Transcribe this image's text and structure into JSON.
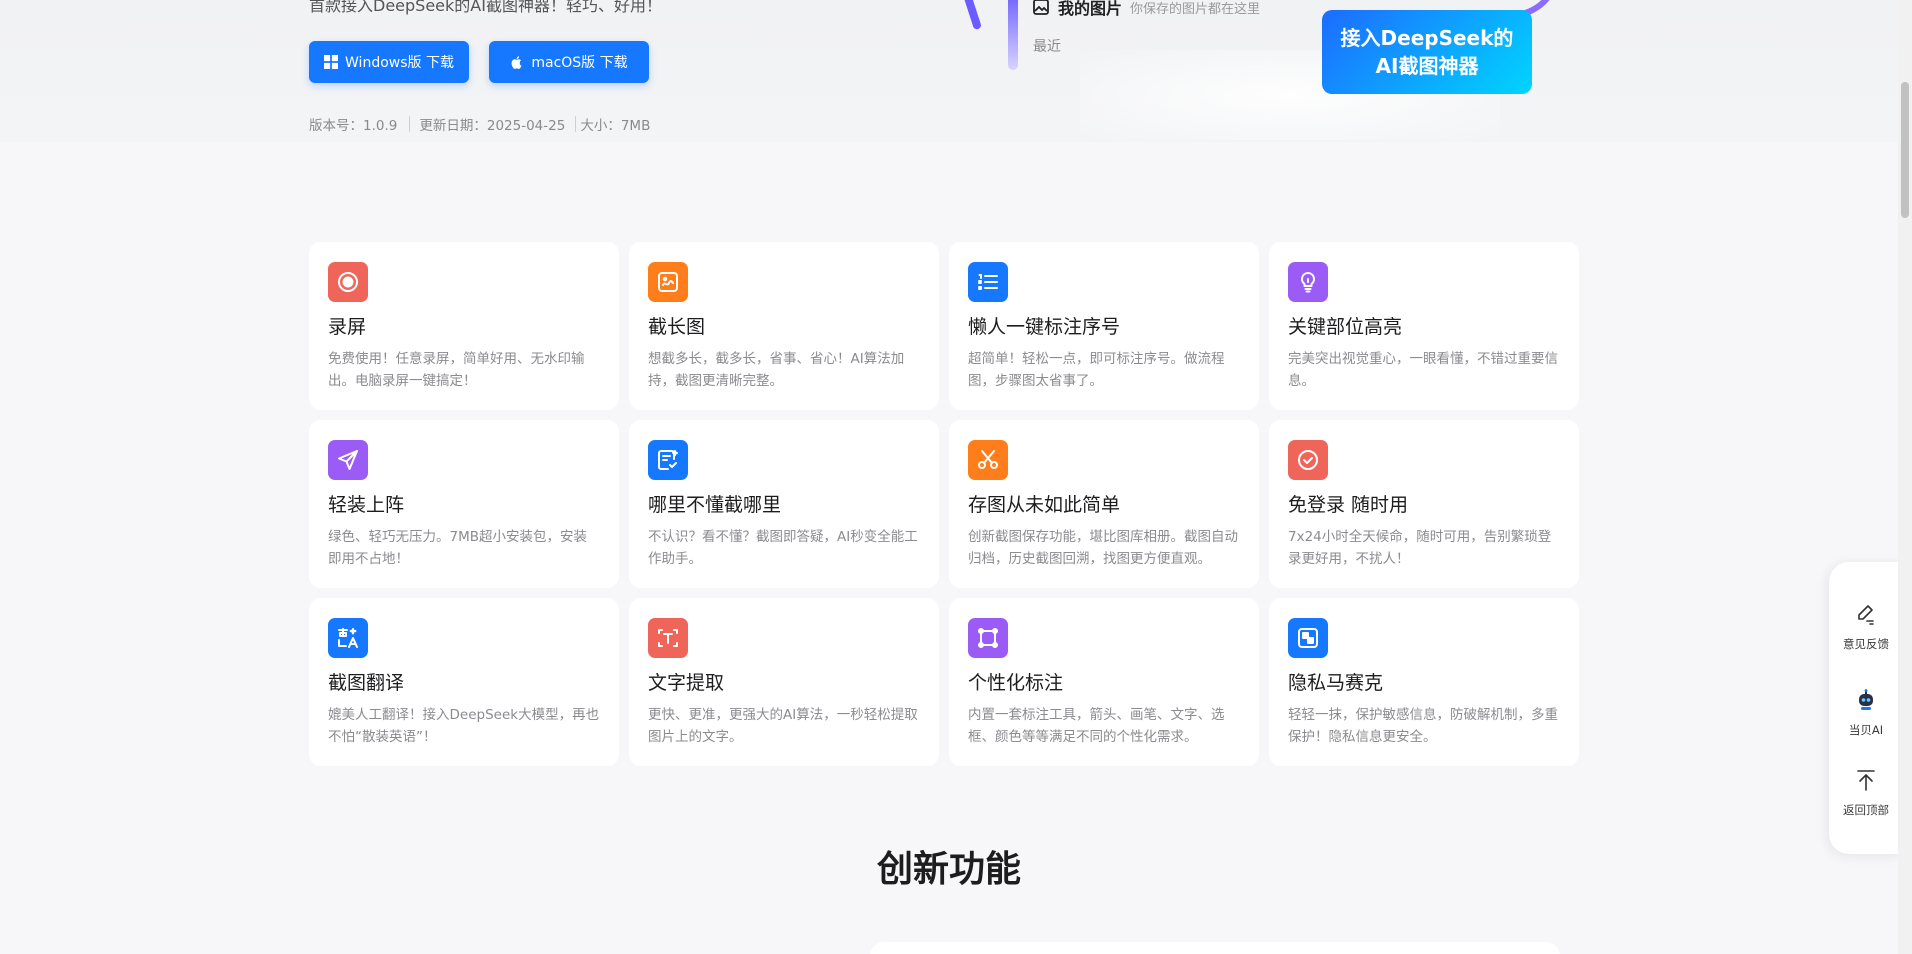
{
  "hero": {
    "subtitle": "首款接入DeepSeek的AI截图神器！轻巧、好用！",
    "windows_button": "Windows版 下载",
    "mac_button": "macOS版 下载",
    "version": "版本号：1.0.9",
    "update_date": "更新日期：2025-04-25",
    "size": "大小：7MB",
    "art": {
      "my_pictures": "我的图片",
      "my_pictures_hint": "你保存的图片都在这里",
      "recent": "最近",
      "badge_line1": "接入DeepSeek的",
      "badge_line2": "AI截图神器"
    }
  },
  "features": [
    {
      "title": "录屏",
      "desc": "免费使用！任意录屏，简单好用、无水印输出。电脑录屏一键搞定！",
      "icon": "record-icon",
      "color": "#f0655a"
    },
    {
      "title": "截长图",
      "desc": "想截多长，截多长，省事、省心！AI算法加持，截图更清晰完整。",
      "icon": "long-screenshot-icon",
      "color": "#ff7d1a"
    },
    {
      "title": "懒人一键标注序号",
      "desc": "超简单！轻松一点，即可标注序号。做流程图，步骤图太省事了。",
      "icon": "numbered-list-icon",
      "color": "#1677ff"
    },
    {
      "title": "关键部位高亮",
      "desc": "完美突出视觉重心，一眼看懂，不错过重要信息。",
      "icon": "lightbulb-icon",
      "color": "#9b5cf6"
    },
    {
      "title": "轻装上阵",
      "desc": "绿色、轻巧无压力。7MB超小安装包，安装即用不占地！",
      "icon": "paper-plane-icon",
      "color": "#9b5cf6"
    },
    {
      "title": "哪里不懂截哪里",
      "desc": "不认识？看不懂？截图即答疑，AI秒变全能工作助手。",
      "icon": "ai-note-icon",
      "color": "#1677ff"
    },
    {
      "title": "存图从未如此简单",
      "desc": "创新截图保存功能，堪比图库相册。截图自动归档，历史截图回溯，找图更方便直观。",
      "icon": "scissors-icon",
      "color": "#ff7d1a"
    },
    {
      "title": "免登录 随时用",
      "desc": "7x24小时全天候命，随时可用，告别繁琐登录更好用，不扰人！",
      "icon": "check-circle-icon",
      "color": "#f0655a"
    },
    {
      "title": "截图翻译",
      "desc": "媲美人工翻译！接入DeepSeek大模型，再也不怕“散装英语”！",
      "icon": "translate-icon",
      "color": "#1677ff"
    },
    {
      "title": "文字提取",
      "desc": "更快、更准，更强大的AI算法，一秒轻松提取图片上的文字。",
      "icon": "text-extract-icon",
      "color": "#f0655a"
    },
    {
      "title": "个性化标注",
      "desc": "内置一套标注工具，箭头、画笔、文字、选框、颜色等等满足不同的个性化需求。",
      "icon": "annotate-icon",
      "color": "#9b5cf6"
    },
    {
      "title": "隐私马赛克",
      "desc": "轻轻一抹，保护敏感信息，防破解机制，多重保护！隐私信息更安全。",
      "icon": "mosaic-icon",
      "color": "#1677ff"
    }
  ],
  "section": {
    "title": "创新功能"
  },
  "floatbar": {
    "feedback": "意见反馈",
    "ai": "当贝AI",
    "top": "返回顶部"
  }
}
